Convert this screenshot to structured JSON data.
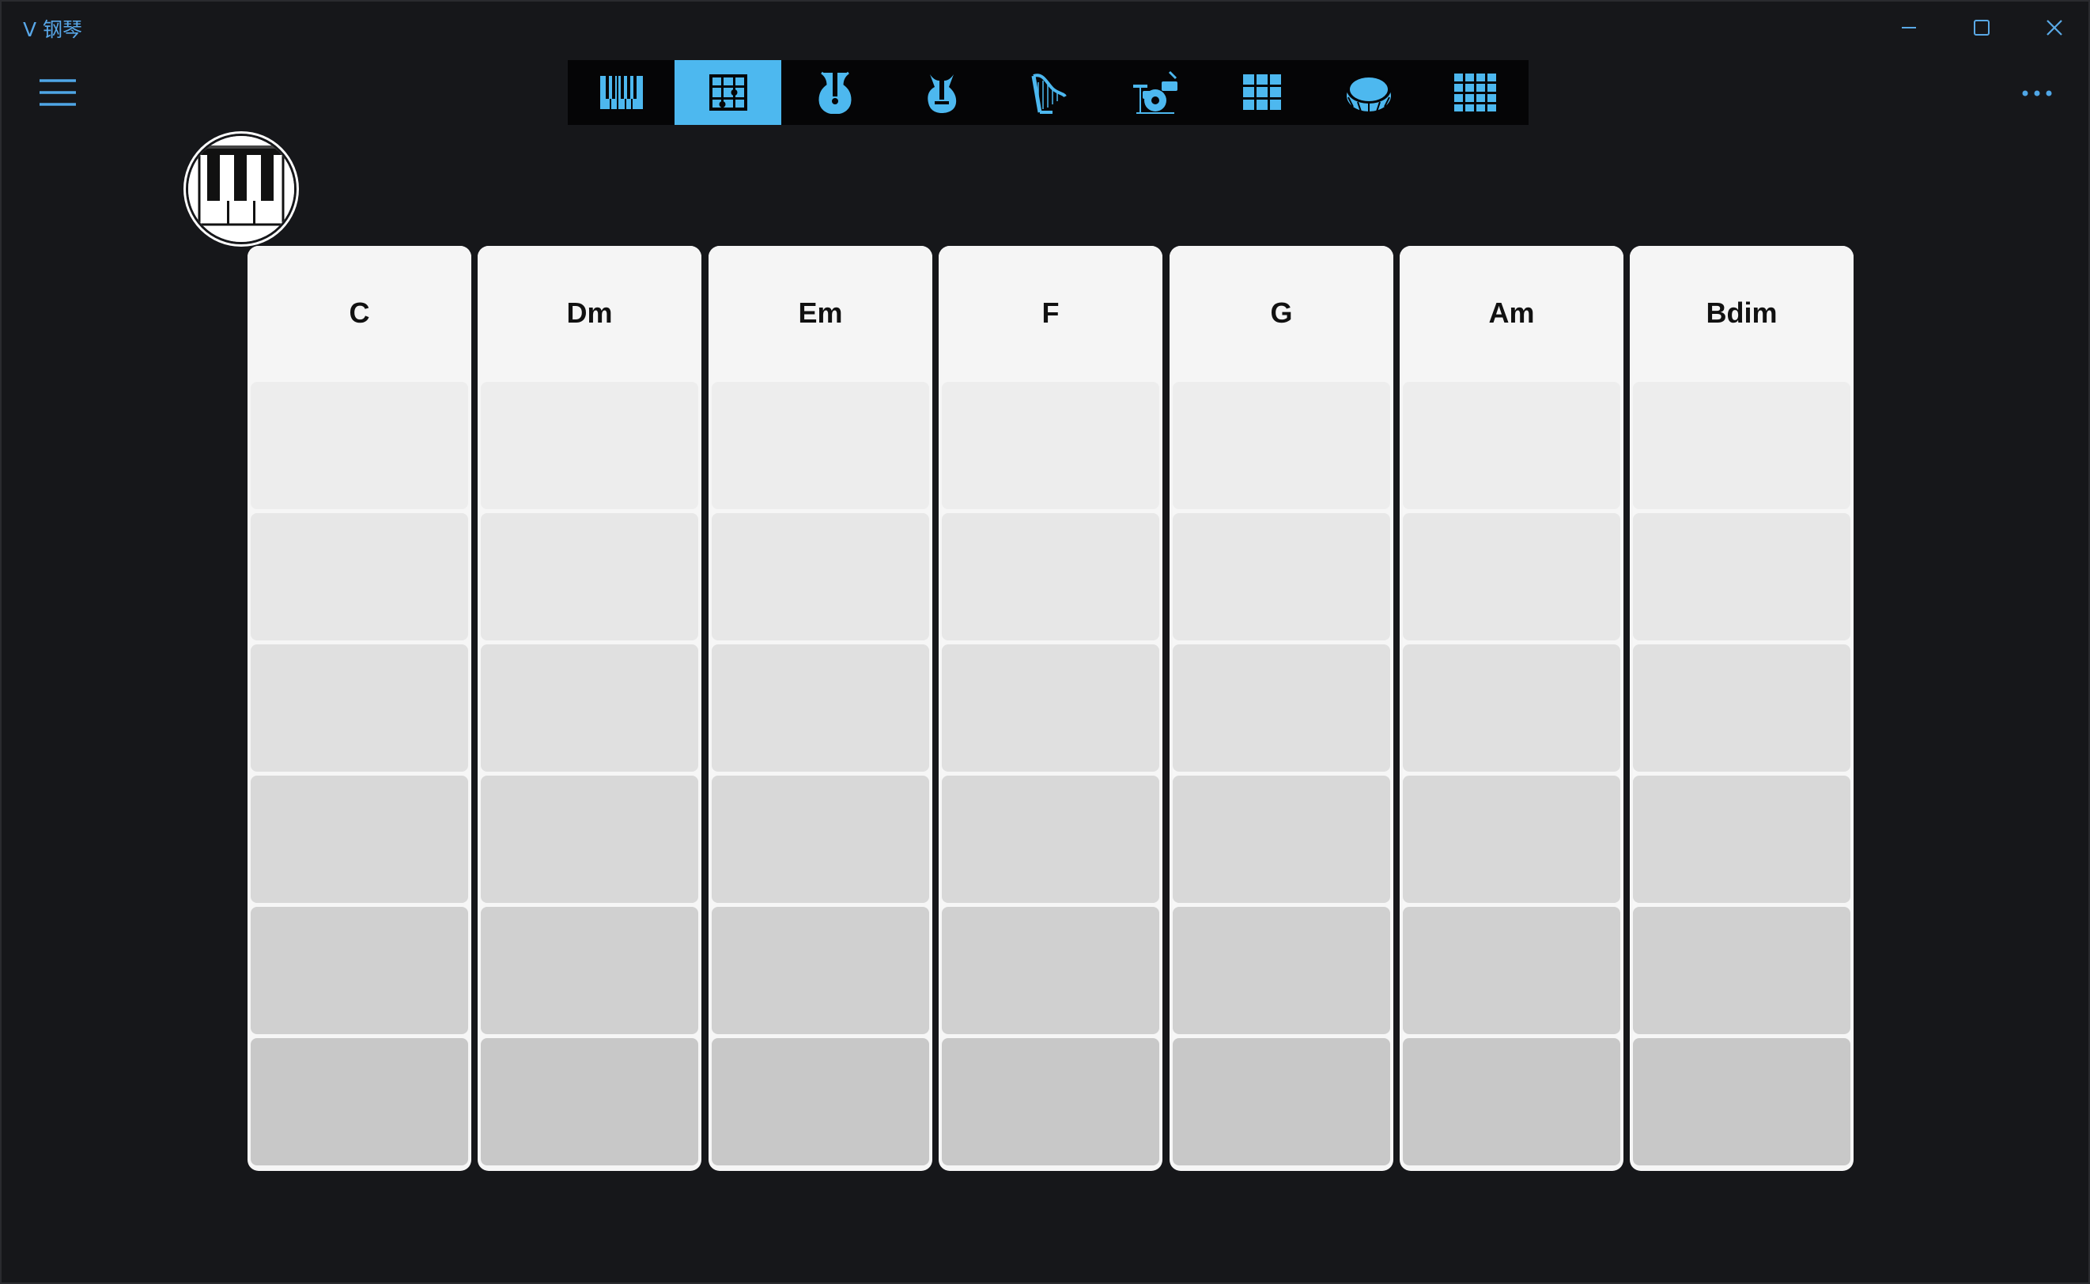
{
  "window": {
    "title": "V 钢琴"
  },
  "toolbar": {
    "items": [
      {
        "icon": "piano-keys-icon",
        "active": false
      },
      {
        "icon": "chord-grid-icon",
        "active": true
      },
      {
        "icon": "acoustic-guitar-icon",
        "active": false
      },
      {
        "icon": "electric-guitar-icon",
        "active": false
      },
      {
        "icon": "harp-icon",
        "active": false
      },
      {
        "icon": "drum-kit-icon",
        "active": false
      },
      {
        "icon": "pad-3x3-icon",
        "active": false
      },
      {
        "icon": "snare-drum-icon",
        "active": false
      },
      {
        "icon": "pad-4x4-icon",
        "active": false
      }
    ],
    "accent_color": "#4db8ef"
  },
  "chords": {
    "columns": [
      "C",
      "Dm",
      "Em",
      "F",
      "G",
      "Am",
      "Bdim"
    ],
    "pads_per_column": 6,
    "pad_colors": [
      "#ededed",
      "#e7e7e7",
      "#e0e0e0",
      "#d8d8d8",
      "#d0d0d0",
      "#c8c8c8"
    ]
  }
}
